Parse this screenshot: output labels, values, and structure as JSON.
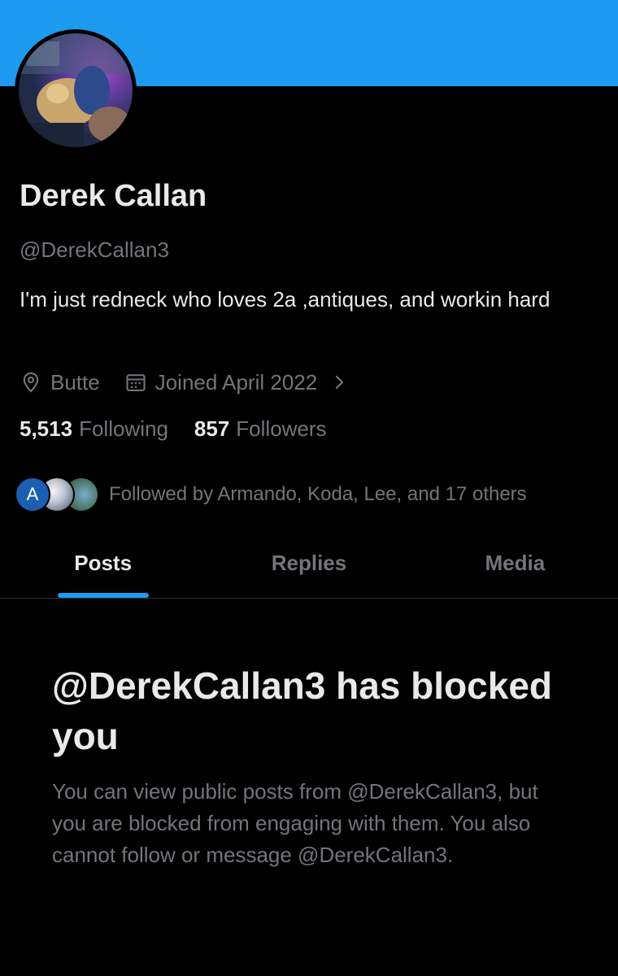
{
  "profile": {
    "name": "Derek Callan",
    "handle": "@DerekCallan3",
    "bio": "I'm just redneck who loves 2a ,antiques, and workin hard",
    "location": "Butte",
    "joined": "Joined April 2022",
    "following_count": "5,513",
    "following_label": "Following",
    "followers_count": "857",
    "followers_label": "Followers"
  },
  "followed_by": {
    "avatar_letter": "A",
    "text": "Followed by Armando, Koda, Lee, and 17 others"
  },
  "tabs": [
    {
      "label": "Posts",
      "active": true
    },
    {
      "label": "Replies",
      "active": false
    },
    {
      "label": "Media",
      "active": false
    }
  ],
  "blocked": {
    "title": "@DerekCallan3 has blocked you",
    "message": "You can view public posts from @DerekCallan3, but you are blocked from engaging with them. You also cannot follow or message @DerekCallan3."
  },
  "colors": {
    "accent": "#1d9bf0",
    "background": "#000000",
    "text_primary": "#e7e9ea",
    "text_secondary": "#71767b"
  },
  "icons": {
    "location": "location-pin-icon",
    "calendar": "calendar-icon",
    "chevron": "chevron-right-icon"
  }
}
